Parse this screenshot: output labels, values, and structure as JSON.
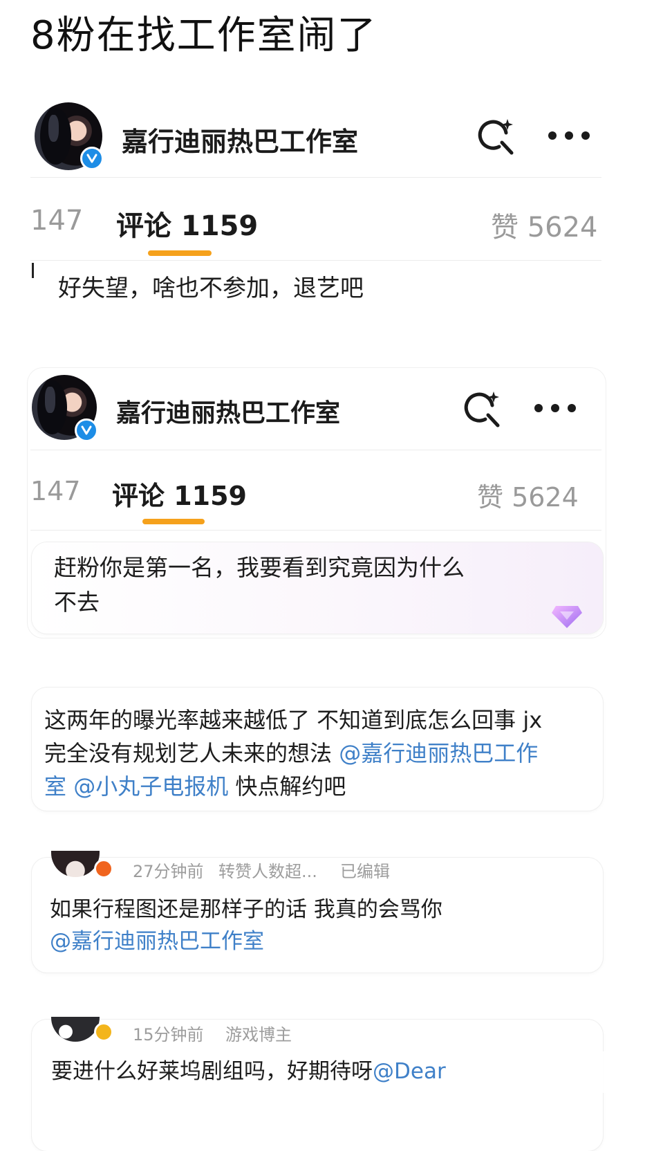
{
  "post": {
    "title": "8粉在找工作室闹了"
  },
  "screens": [
    {
      "studio_name": "嘉行迪丽热巴工作室",
      "tabs": {
        "repost": "147",
        "comment": "评论 1159",
        "like": "赞 5624"
      },
      "comment": "好失望，啥也不参加，退艺吧"
    },
    {
      "studio_name": "嘉行迪丽热巴工作室",
      "tabs": {
        "repost": "147",
        "comment": "评论 1159",
        "like": "赞 5624"
      },
      "comment_line1": "赶粉你是第一名，我要看到究竟因为什么",
      "comment_line2": "不去"
    }
  ],
  "comments": [
    {
      "line1": "这两年的曝光率越来越低了 不知道到底怎么回事 jx",
      "line2_text": "完全没有规划艺人未来的想法 ",
      "line2_mention": "@嘉行迪丽热巴工作",
      "line3_mention_a": "室",
      "line3_mention_b": "@小丸子电报机",
      "line3_text": " 快点解约吧"
    },
    {
      "meta_time": "27分钟前",
      "meta_extra": "转赞人数超...",
      "meta_edit": "已编辑",
      "line1": "如果行程图还是那样子的话 我真的会骂你",
      "line2_mention": "@嘉行迪丽热巴工作室"
    },
    {
      "meta_time": "15分钟前",
      "meta_tag": "游戏博主",
      "line1_text": "要进什么好莱坞剧组吗，好期待呀",
      "line1_mention": "@Dear"
    }
  ],
  "colors": {
    "accent_underline": "#f5a11c",
    "verified_blue": "#1d8de6",
    "verified_orange": "#f0641e",
    "verified_gold": "#f3b51c",
    "mention": "#3f80c8"
  },
  "icons": [
    "search-sparkle-icon",
    "more-icon",
    "verified-icon",
    "diamond-icon"
  ]
}
